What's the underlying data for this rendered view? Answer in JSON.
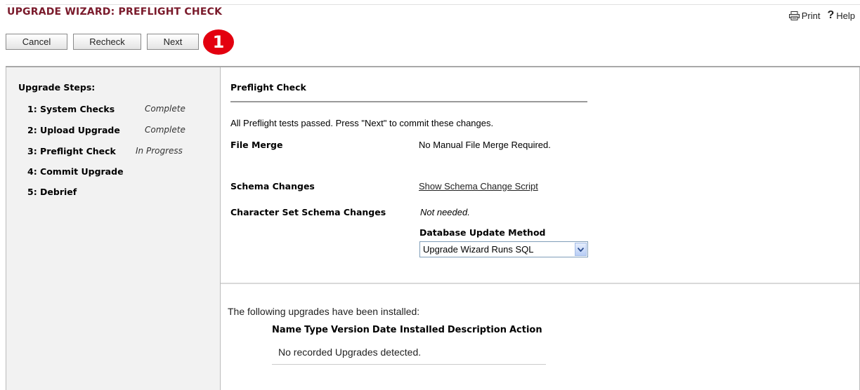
{
  "header": {
    "title": "UPGRADE WIZARD: PREFLIGHT CHECK",
    "print_label": "Print",
    "help_label": "Help",
    "help_glyph": "?"
  },
  "toolbar": {
    "cancel_label": "Cancel",
    "recheck_label": "Recheck",
    "next_label": "Next"
  },
  "callout": {
    "text": "1",
    "color": "#e3000f"
  },
  "sidebar": {
    "title": "Upgrade Steps:",
    "steps": [
      {
        "label": "1: System Checks",
        "status": "Complete"
      },
      {
        "label": "2: Upload Upgrade",
        "status": "Complete"
      },
      {
        "label": "3: Preflight Check",
        "status": "In Progress"
      },
      {
        "label": "4: Commit Upgrade",
        "status": ""
      },
      {
        "label": "5: Debrief",
        "status": ""
      }
    ]
  },
  "main": {
    "section_title": "Preflight Check",
    "status_message": "All Preflight tests passed. Press \"Next\" to commit these changes.",
    "file_merge": {
      "label": "File Merge",
      "value": "No Manual File Merge Required."
    },
    "schema_changes": {
      "label": "Schema Changes",
      "link": "Show Schema Change Script"
    },
    "charset_changes": {
      "label": "Character Set Schema Changes",
      "value": "Not needed."
    },
    "db_update": {
      "label": "Database Update Method",
      "selected": "Upgrade Wizard Runs SQL"
    }
  },
  "installed": {
    "message": "The following upgrades have been installed:",
    "columns": [
      "Name",
      "Type",
      "Version",
      "Date Installed",
      "Description",
      "Action"
    ],
    "empty_text": "No recorded Upgrades detected."
  },
  "colors": {
    "title": "#7a1a2b",
    "sidebar_bg": "#f2f2f2"
  }
}
